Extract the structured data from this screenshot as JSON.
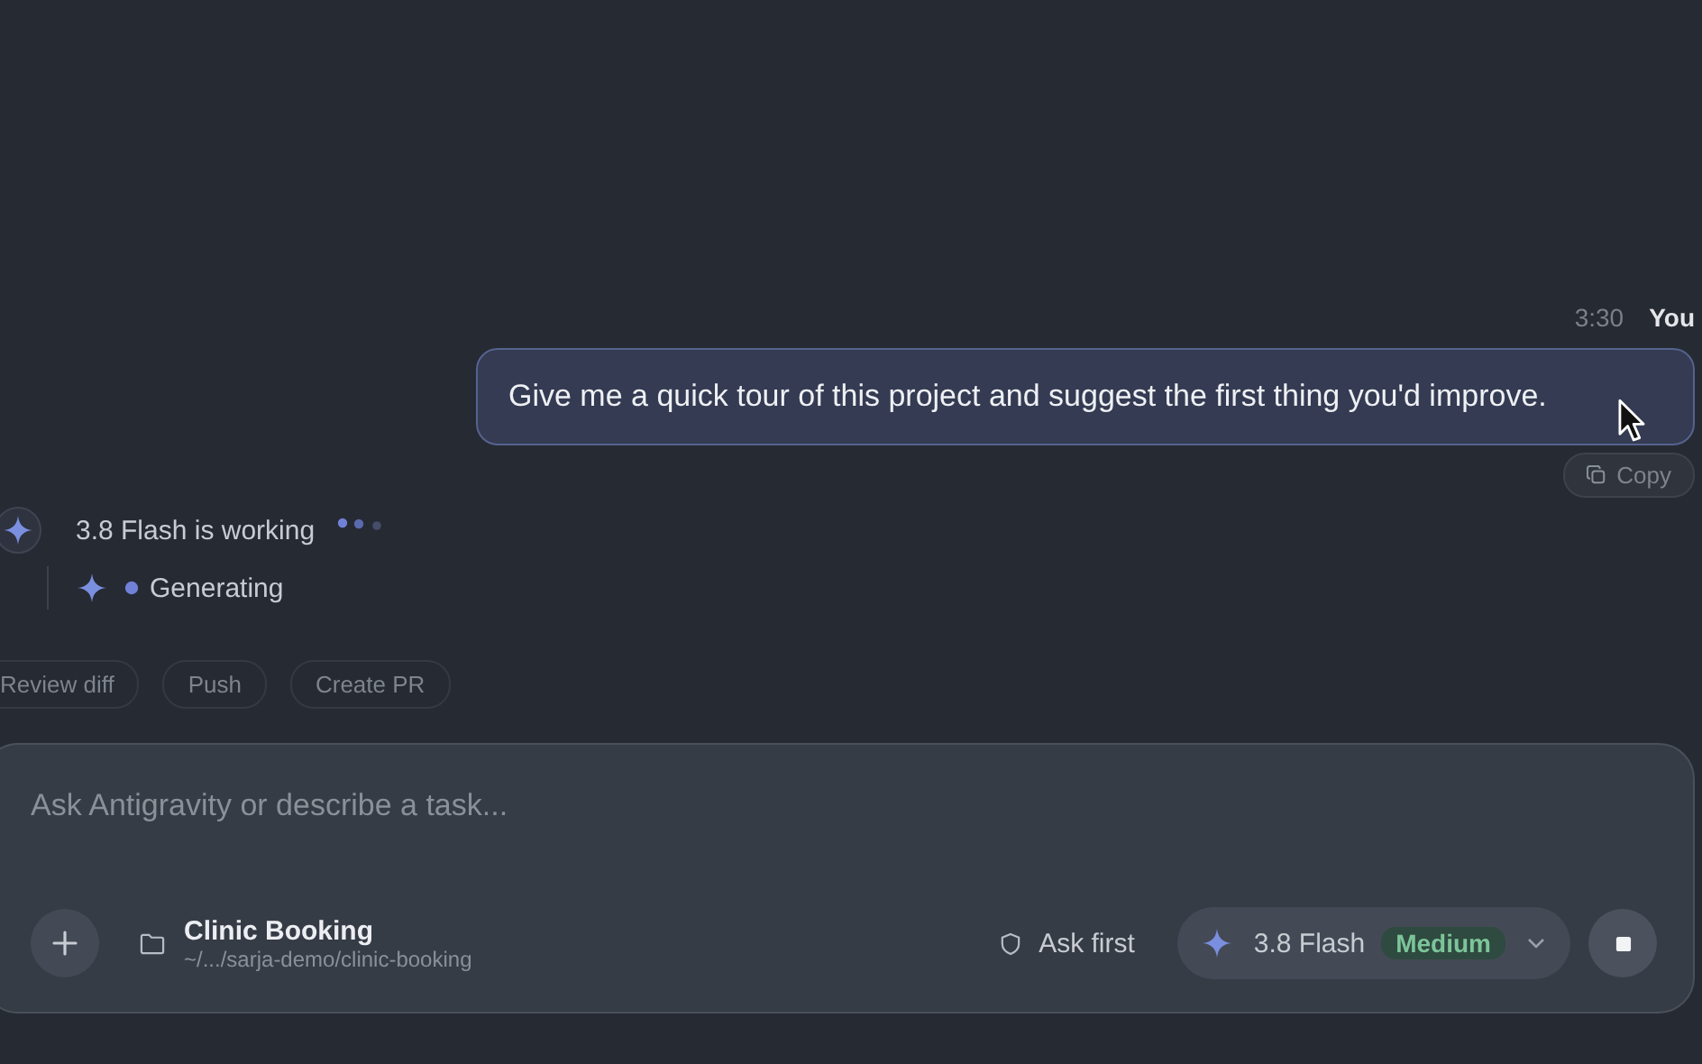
{
  "messages": [
    {
      "kind": "user",
      "time": "3:30",
      "author": "You",
      "text": "Give me a quick tour of this project and suggest the first thing you'd improve.",
      "actions": [
        "Copy"
      ]
    }
  ],
  "agent_status": {
    "label": "3.8 Flash is working",
    "steps": [
      {
        "label": "Generating"
      }
    ]
  },
  "quick_actions": [
    "Review diff",
    "Push",
    "Create PR"
  ],
  "composer": {
    "placeholder": "Ask Antigravity or describe a task...",
    "project": {
      "name": "Clinic Booking",
      "path": "~/.../sarja-demo/clinic-booking"
    },
    "permission": "Ask first",
    "model": {
      "name": "3.8 Flash",
      "effort": "Medium"
    }
  }
}
